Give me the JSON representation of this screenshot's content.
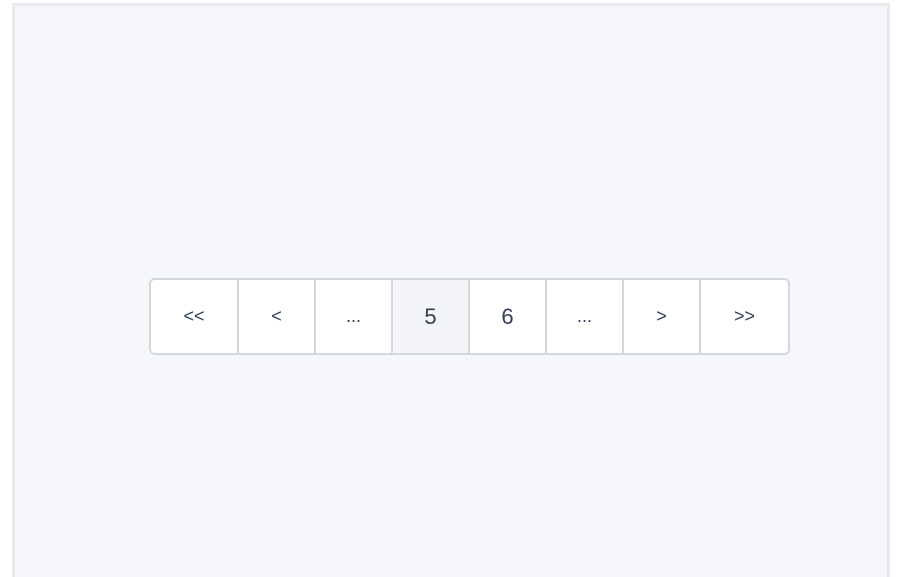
{
  "pagination": {
    "first_label": "<<",
    "prev_label": "<",
    "ellipsis_left_label": "...",
    "pages": [
      {
        "label": "5",
        "active": true
      },
      {
        "label": "6",
        "active": false
      }
    ],
    "ellipsis_right_label": "...",
    "next_label": ">",
    "last_label": ">>"
  },
  "colors": {
    "background": "#f5f7fa",
    "border": "#d3d8df",
    "text": "#334155",
    "active_background": "#f3f5f8"
  }
}
